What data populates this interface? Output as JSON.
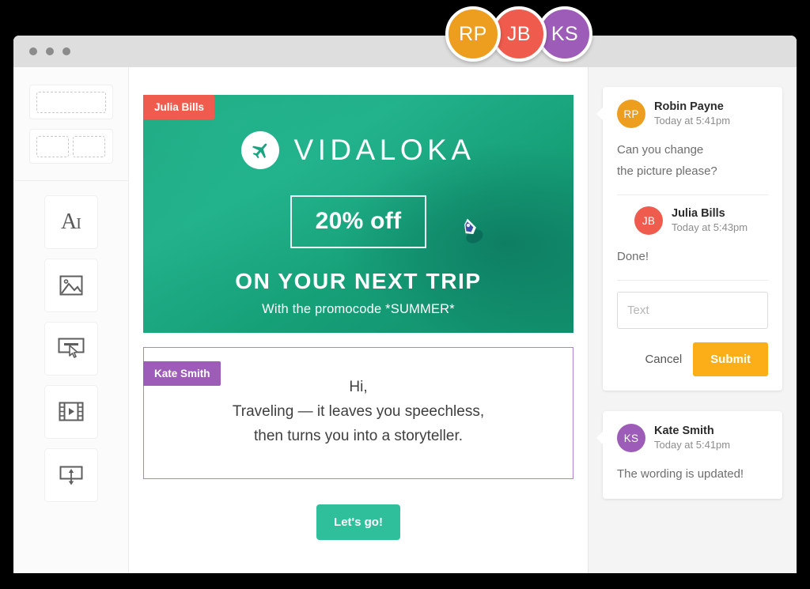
{
  "window": {
    "traffic_lights": [
      "close",
      "minimize",
      "maximize"
    ]
  },
  "avatars": [
    {
      "initials": "RP",
      "color": "#ED9E1E",
      "name": "Robin Payne"
    },
    {
      "initials": "JB",
      "color": "#EF5B4C",
      "name": "Julia Bills"
    },
    {
      "initials": "KS",
      "color": "#9D5CB8",
      "name": "Kate Smith"
    }
  ],
  "sidebar": {
    "layouts": [
      {
        "name": "one-column-layout",
        "columns": 1
      },
      {
        "name": "two-column-layout",
        "columns": 2
      }
    ],
    "tools": [
      {
        "name": "text-tool",
        "icon": "text-icon",
        "label": "A",
        "sub": "I"
      },
      {
        "name": "image-tool",
        "icon": "image-icon"
      },
      {
        "name": "button-tool",
        "icon": "button-icon"
      },
      {
        "name": "video-tool",
        "icon": "video-icon"
      },
      {
        "name": "divider-tool",
        "icon": "divider-icon"
      }
    ]
  },
  "canvas": {
    "banner": {
      "tag": "Julia Bills",
      "tag_color": "#EF5B4C",
      "brand": "VIDALOKA",
      "logo_icon": "airplane-icon",
      "offer": "20% off",
      "headline": "ON YOUR NEXT TRIP",
      "subline": "With the promocode *SUMMER*",
      "background_color": "#17A47E"
    },
    "textblock": {
      "tag": "Kate Smith",
      "tag_color": "#9D5CB8",
      "line1": "Hi,",
      "line2": "Traveling — it leaves you speechless,",
      "line3": "then turns you into a storyteller."
    },
    "cta": {
      "label": "Let's go!",
      "color": "#2FBF9A"
    }
  },
  "comments": [
    {
      "author": "Robin Payne",
      "initials": "RP",
      "color": "#ED9E1E",
      "time": "Today at 5:41pm",
      "body_line1": "Can you change",
      "body_line2": "the picture please?",
      "reply": {
        "author": "Julia Bills",
        "initials": "JB",
        "color": "#EF5B4C",
        "time": "Today at 5:43pm",
        "body": "Done!"
      },
      "input": {
        "value": "",
        "placeholder": "Text"
      },
      "cancel_label": "Cancel",
      "submit_label": "Submit",
      "submit_color": "#FBAE17"
    },
    {
      "author": "Kate Smith",
      "initials": "KS",
      "color": "#9D5CB8",
      "time": "Today at 5:41pm",
      "body": "The wording is updated!"
    }
  ]
}
